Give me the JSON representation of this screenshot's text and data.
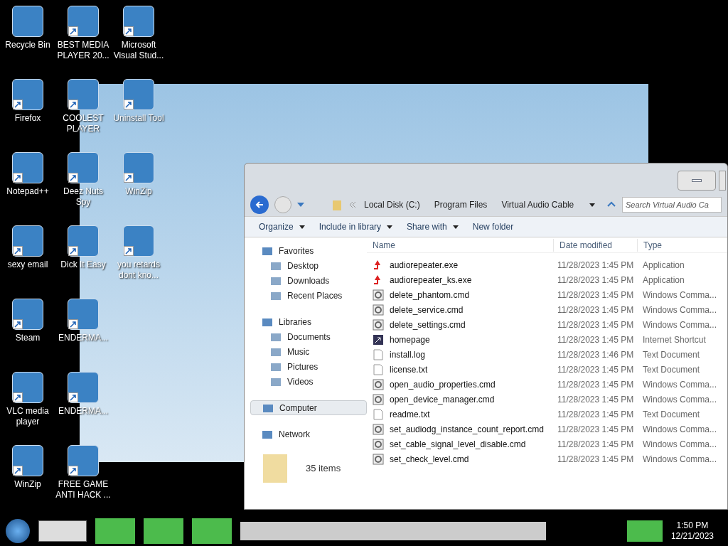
{
  "desktop_icons": [
    {
      "label": "Recycle Bin",
      "shortcut": false
    },
    {
      "label": "Firefox",
      "shortcut": true
    },
    {
      "label": "Notepad++",
      "shortcut": true
    },
    {
      "label": "sexy email",
      "shortcut": true
    },
    {
      "label": "Steam",
      "shortcut": true
    },
    {
      "label": "VLC media player",
      "shortcut": true
    },
    {
      "label": "WinZip",
      "shortcut": true
    },
    {
      "label": "BEST MEDIA PLAYER 20...",
      "shortcut": true
    },
    {
      "label": "COOLEST PLAYER",
      "shortcut": true
    },
    {
      "label": "Deez Nuts Spy",
      "shortcut": true
    },
    {
      "label": "Dick It Easy",
      "shortcut": true
    },
    {
      "label": "ENDERMA...",
      "shortcut": true
    },
    {
      "label": "ENDERMA...",
      "shortcut": true
    },
    {
      "label": "FREE GAME ANTI HACK ...",
      "shortcut": true
    },
    {
      "label": "Microsoft Visual Stud...",
      "shortcut": true
    },
    {
      "label": "Uninstall Tool",
      "shortcut": true
    },
    {
      "label": "WinZip",
      "shortcut": true
    },
    {
      "label": "you retards dont kno...",
      "shortcut": true
    }
  ],
  "explorer": {
    "breadcrumb": [
      "Local Disk (C:)",
      "Program Files",
      "Virtual Audio Cable"
    ],
    "search": {
      "placeholder": "Search Virtual Audio Ca"
    },
    "toolbar": [
      {
        "label": "Organize",
        "dropdown": true
      },
      {
        "label": "Include in library",
        "dropdown": true
      },
      {
        "label": "Share with",
        "dropdown": true
      },
      {
        "label": "New folder",
        "dropdown": false
      }
    ],
    "sidebar": [
      {
        "label": "Favorites",
        "selected": false,
        "children": [
          {
            "label": "Desktop",
            "selected": false
          },
          {
            "label": "Downloads",
            "selected": false
          },
          {
            "label": "Recent Places",
            "selected": false
          }
        ]
      },
      {
        "label": "Libraries",
        "selected": false,
        "children": [
          {
            "label": "Documents",
            "selected": false
          },
          {
            "label": "Music",
            "selected": false
          },
          {
            "label": "Pictures",
            "selected": false
          },
          {
            "label": "Videos",
            "selected": false
          }
        ]
      },
      {
        "label": "Computer",
        "selected": true
      },
      {
        "label": "Network",
        "selected": false
      }
    ],
    "columns": [
      "Name",
      "Date modified",
      "Type"
    ],
    "rows": [
      {
        "kind": "exe",
        "name": "audiorepeater.exe",
        "date": "11/28/2023 1:45 PM",
        "type": "Application"
      },
      {
        "kind": "exe",
        "name": "audiorepeater_ks.exe",
        "date": "11/28/2023 1:45 PM",
        "type": "Application"
      },
      {
        "kind": "cmd",
        "name": "delete_phantom.cmd",
        "date": "11/28/2023 1:45 PM",
        "type": "Windows Comma..."
      },
      {
        "kind": "cmd",
        "name": "delete_service.cmd",
        "date": "11/28/2023 1:45 PM",
        "type": "Windows Comma..."
      },
      {
        "kind": "cmd",
        "name": "delete_settings.cmd",
        "date": "11/28/2023 1:45 PM",
        "type": "Windows Comma..."
      },
      {
        "kind": "url",
        "name": "homepage",
        "date": "11/28/2023 1:45 PM",
        "type": "Internet Shortcut"
      },
      {
        "kind": "txt",
        "name": "install.log",
        "date": "11/28/2023 1:46 PM",
        "type": "Text Document"
      },
      {
        "kind": "txt",
        "name": "license.txt",
        "date": "11/28/2023 1:45 PM",
        "type": "Text Document"
      },
      {
        "kind": "cmd",
        "name": "open_audio_properties.cmd",
        "date": "11/28/2023 1:45 PM",
        "type": "Windows Comma..."
      },
      {
        "kind": "cmd",
        "name": "open_device_manager.cmd",
        "date": "11/28/2023 1:45 PM",
        "type": "Windows Comma..."
      },
      {
        "kind": "txt",
        "name": "readme.txt",
        "date": "11/28/2023 1:45 PM",
        "type": "Text Document"
      },
      {
        "kind": "cmd",
        "name": "set_audiodg_instance_count_report.cmd",
        "date": "11/28/2023 1:45 PM",
        "type": "Windows Comma..."
      },
      {
        "kind": "cmd",
        "name": "set_cable_signal_level_disable.cmd",
        "date": "11/28/2023 1:45 PM",
        "type": "Windows Comma..."
      },
      {
        "kind": "cmd",
        "name": "set_check_level.cmd",
        "date": "11/28/2023 1:45 PM",
        "type": "Windows Comma..."
      }
    ],
    "status": "35 items"
  },
  "taskbar": {
    "time": "1:50 PM",
    "date": "12/21/2023"
  }
}
